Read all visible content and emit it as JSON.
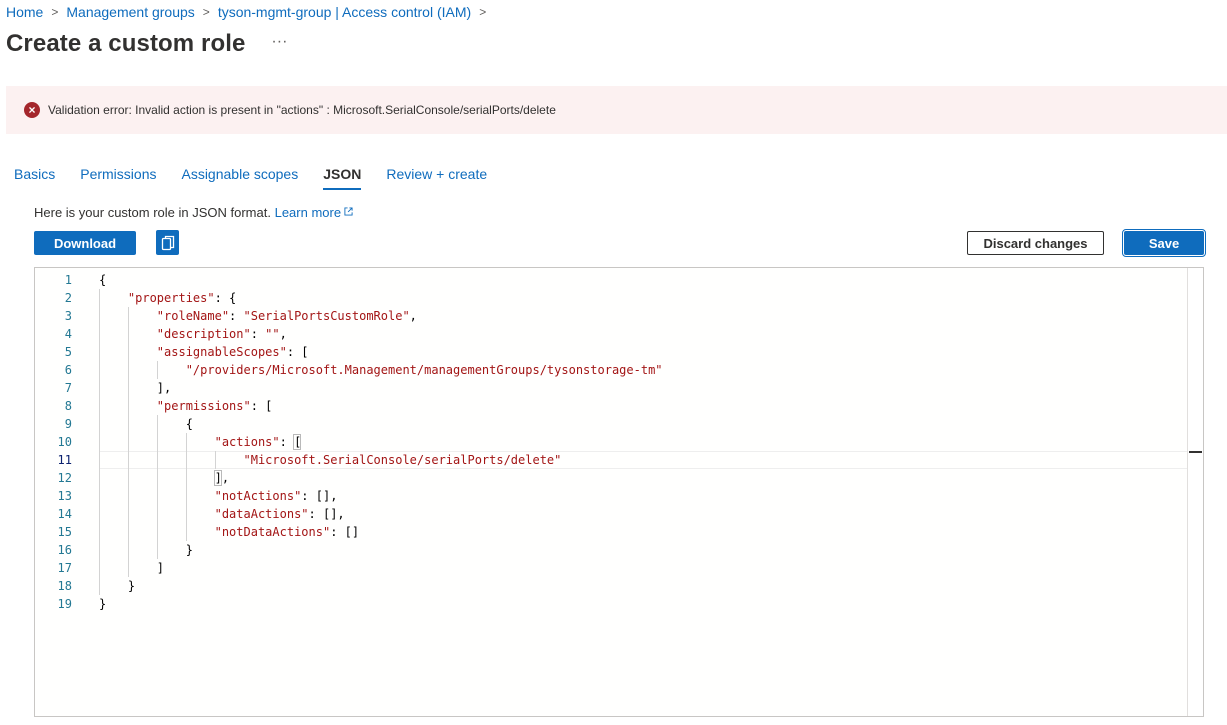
{
  "breadcrumb": {
    "items": [
      "Home",
      "Management groups",
      "tyson-mgmt-group | Access control (IAM)"
    ],
    "separator": ">"
  },
  "page": {
    "title": "Create a custom role",
    "more_label": "···"
  },
  "error_banner": {
    "icon": "error-circle-x-icon",
    "icon_glyph": "×",
    "message": "Validation error: Invalid action is present in \"actions\" : Microsoft.SerialConsole/serialPorts/delete",
    "background": "#fcf1f1",
    "icon_color": "#a4262c"
  },
  "tabs": [
    {
      "label": "Basics",
      "active": false
    },
    {
      "label": "Permissions",
      "active": false
    },
    {
      "label": "Assignable scopes",
      "active": false
    },
    {
      "label": "JSON",
      "active": true
    },
    {
      "label": "Review + create",
      "active": false
    }
  ],
  "info": {
    "text": "Here is your custom role in JSON format.",
    "link": "Learn more",
    "link_icon": "external-link-icon"
  },
  "toolbar": {
    "download_label": "Download",
    "copy_icon": "copy-icon",
    "discard_label": "Discard changes",
    "save_label": "Save"
  },
  "colors": {
    "accent": "#0f6cbd",
    "text": "#323130",
    "json_string": "#a31515",
    "line_number": "#237893"
  },
  "editor": {
    "current_line": 11,
    "lines": [
      "{",
      "    \"properties\": {",
      "        \"roleName\": \"SerialPortsCustomRole\",",
      "        \"description\": \"\",",
      "        \"assignableScopes\": [",
      "            \"/providers/Microsoft.Management/managementGroups/tysonstorage-tm\"",
      "        ],",
      "        \"permissions\": [",
      "            {",
      "                \"actions\": [",
      "                    \"Microsoft.SerialConsole/serialPorts/delete\"",
      "                ],",
      "                \"notActions\": [],",
      "                \"dataActions\": [],",
      "                \"notDataActions\": []",
      "            }",
      "        ]",
      "    }",
      "}"
    ]
  }
}
